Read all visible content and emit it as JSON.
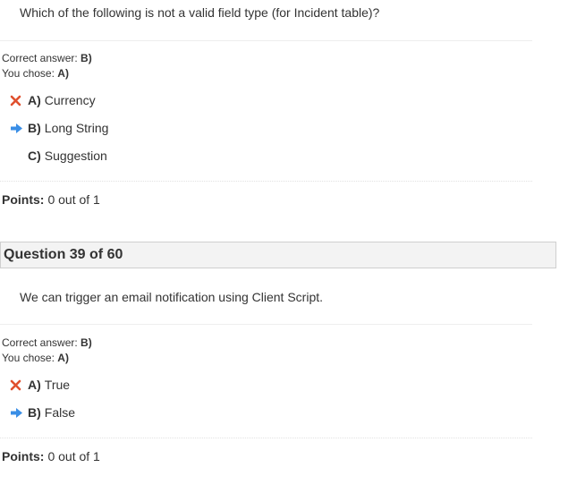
{
  "q38": {
    "question": "Which of the following is not a valid field type (for Incident table)?",
    "correct_label": "Correct answer:",
    "correct_value": "B)",
    "chose_label": "You chose:",
    "chose_value": "A)",
    "options": [
      {
        "letter": "A)",
        "text": "Currency",
        "mark": "wrong"
      },
      {
        "letter": "B)",
        "text": "Long String",
        "mark": "correct"
      },
      {
        "letter": "C)",
        "text": "Suggestion",
        "mark": "none"
      }
    ],
    "points_label": "Points:",
    "points_value": "0 out of 1"
  },
  "q39": {
    "header": "Question 39 of 60",
    "question": "We can trigger an email notification using Client Script.",
    "correct_label": "Correct answer:",
    "correct_value": "B)",
    "chose_label": "You chose:",
    "chose_value": "A)",
    "options": [
      {
        "letter": "A)",
        "text": "True",
        "mark": "wrong"
      },
      {
        "letter": "B)",
        "text": "False",
        "mark": "correct"
      }
    ],
    "points_label": "Points:",
    "points_value": "0 out of 1"
  },
  "colors": {
    "wrong_mark": "#e0502e",
    "correct_arrow": "#3a8ee6",
    "header_bg": "#f3f3f3",
    "header_border": "#cfcfcf"
  },
  "icons": {
    "wrong": "red-x-icon",
    "correct": "blue-arrow-right-icon"
  }
}
